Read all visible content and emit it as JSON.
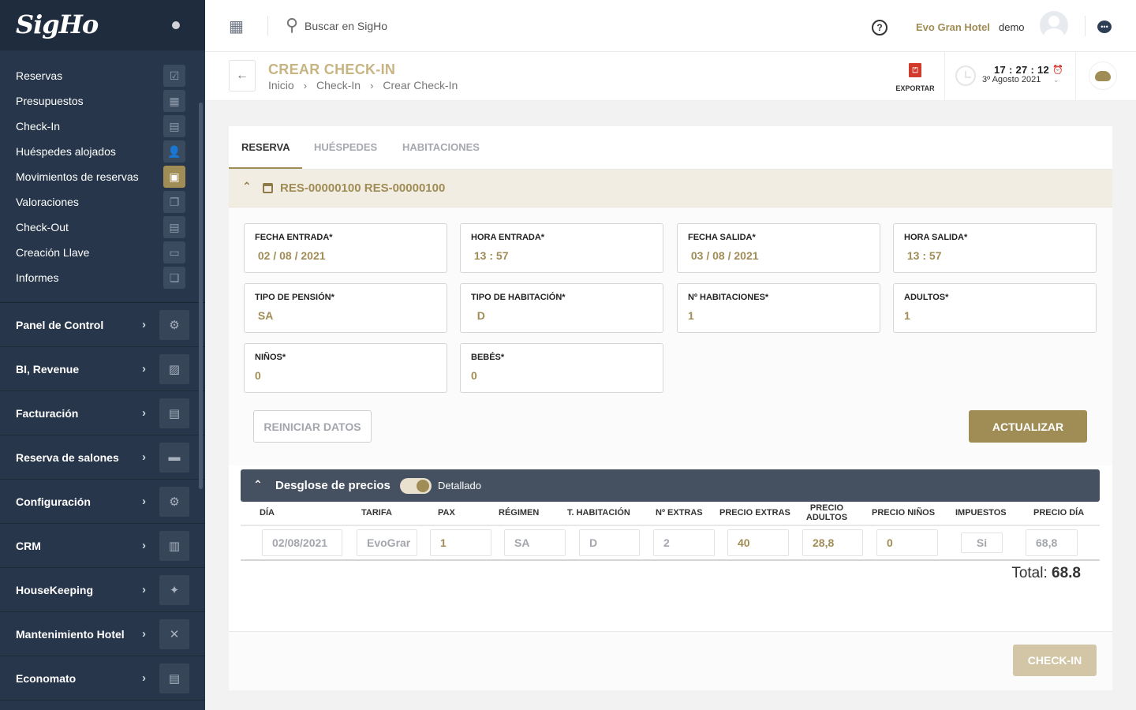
{
  "sidebar": {
    "logo": "SigHo",
    "quick_items": [
      {
        "label": "Reservas",
        "icon": "calendar-check-icon"
      },
      {
        "label": "Presupuestos",
        "icon": "budget-icon"
      },
      {
        "label": "Check-In",
        "icon": "checkin-icon"
      },
      {
        "label": "Huéspedes alojados",
        "icon": "guests-icon"
      },
      {
        "label": "Movimientos de reservas",
        "icon": "calendar-edit-icon",
        "active": true
      },
      {
        "label": "Valoraciones",
        "icon": "documents-icon"
      },
      {
        "label": "Check-Out",
        "icon": "checkout-icon"
      },
      {
        "label": "Creación Llave",
        "icon": "key-card-icon"
      },
      {
        "label": "Informes",
        "icon": "report-icon"
      }
    ],
    "sections": [
      {
        "label": "Panel de Control",
        "icon": "user-settings-icon"
      },
      {
        "label": "BI, Revenue",
        "icon": "presentation-icon"
      },
      {
        "label": "Facturación",
        "icon": "invoice-icon"
      },
      {
        "label": "Reserva de salones",
        "icon": "sofa-icon"
      },
      {
        "label": "Configuración",
        "icon": "settings-icon"
      },
      {
        "label": "CRM",
        "icon": "contact-card-icon"
      },
      {
        "label": "HouseKeeping",
        "icon": "cleaning-icon"
      },
      {
        "label": "Mantenimiento Hotel",
        "icon": "tools-icon"
      },
      {
        "label": "Economato",
        "icon": "store-icon"
      }
    ]
  },
  "topbar": {
    "search_placeholder": "Buscar en SigHo",
    "hotel": "Evo Gran Hotel",
    "user": "demo"
  },
  "page_header": {
    "title": "CREAR CHECK-IN",
    "breadcrumb": [
      "Inicio",
      "Check-In",
      "Crear Check-In"
    ],
    "export_label": "EXPORTAR",
    "time": "17 : 27 : 12",
    "date": "3º Agosto 2021"
  },
  "tabs": [
    {
      "label": "RESERVA",
      "active": true
    },
    {
      "label": "HUÉSPEDES",
      "active": false
    },
    {
      "label": "HABITACIONES",
      "active": false
    }
  ],
  "reservation": {
    "title": "RES-00000100 RES-00000100"
  },
  "form": {
    "fields": [
      {
        "label": "FECHA ENTRADA*",
        "value": " 02 / 08 / 2021"
      },
      {
        "label": "HORA ENTRADA*",
        "value": " 13 : 57"
      },
      {
        "label": "FECHA SALIDA*",
        "value": " 03 / 08 / 2021"
      },
      {
        "label": "HORA SALIDA*",
        "value": " 13 : 57"
      },
      {
        "label": "TIPO DE PENSIÓN*",
        "value": " SA"
      },
      {
        "label": "TIPO DE HABITACIÓN*",
        "value": "  D"
      },
      {
        "label": "Nº HABITACIONES*",
        "value": "1"
      },
      {
        "label": "ADULTOS*",
        "value": "1"
      },
      {
        "label": "NIÑOS*",
        "value": "0"
      },
      {
        "label": "BEBÉS*",
        "value": "0"
      }
    ],
    "reset_label": "REINICIAR DATOS",
    "update_label": "ACTUALIZAR"
  },
  "prices": {
    "title": "Desglose de precios",
    "toggle_label": "Detallado",
    "toggle_on": true,
    "columns": [
      "DÍA",
      "TARIFA",
      "PAX",
      "RÉGIMEN",
      "T. HABITACIÓN",
      "Nº EXTRAS",
      "PRECIO EXTRAS",
      "PRECIO ADULTOS",
      "PRECIO NIÑOS",
      "IMPUESTOS",
      "PRECIO DÍA"
    ],
    "row": [
      "02/08/2021",
      "EvoGrar",
      "1",
      "SA",
      "D",
      "2",
      "40",
      "28,8",
      "0",
      "Si",
      "68,8"
    ],
    "total_label": "Total:",
    "total_value": "68.8"
  },
  "footer": {
    "checkin_label": "CHECK-IN"
  },
  "colors": {
    "accent": "#a08c55",
    "sidebar": "#27364a",
    "price_bar": "#455061"
  }
}
